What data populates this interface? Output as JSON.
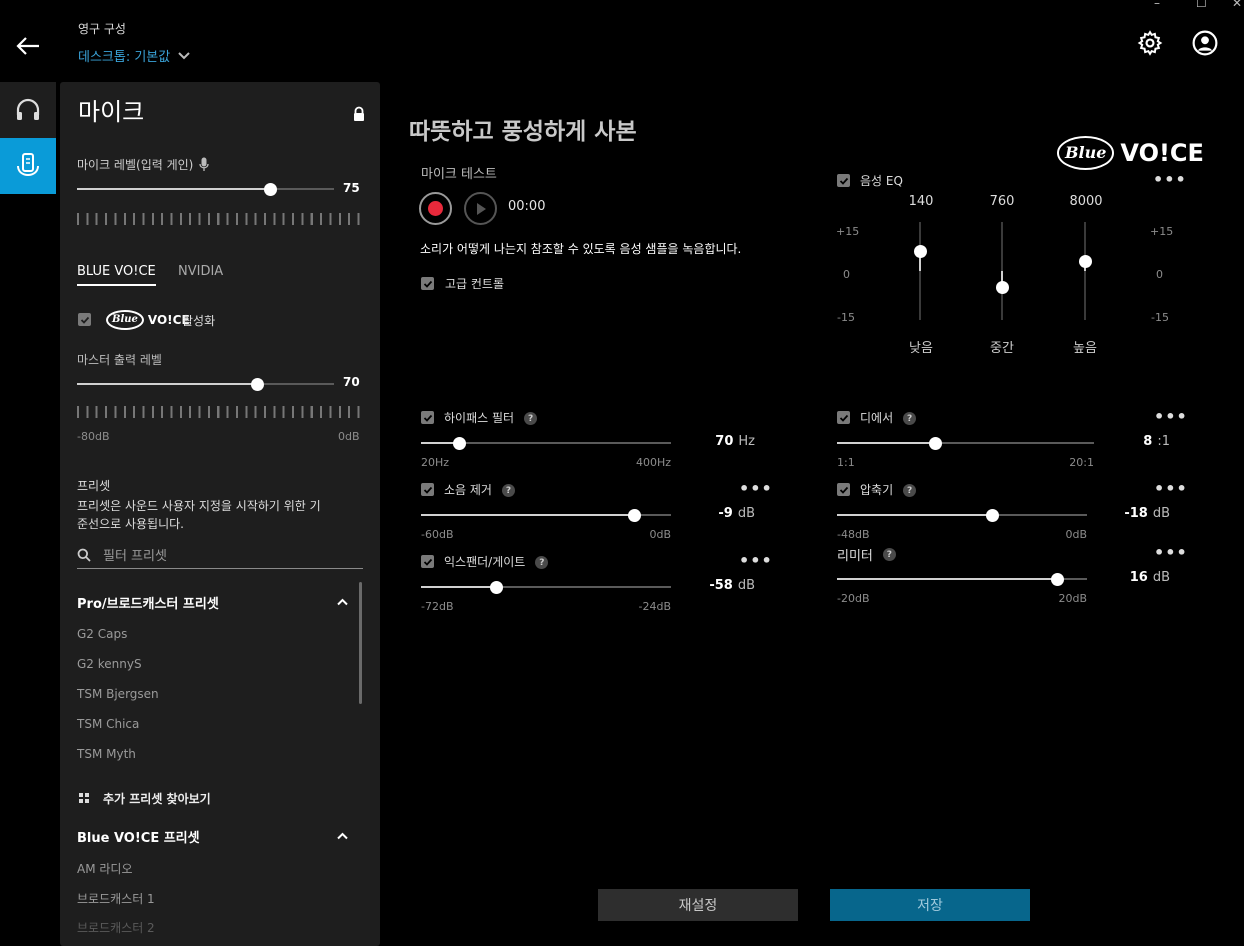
{
  "window": {
    "minimize": "–",
    "maximize": "☐",
    "close": "✕"
  },
  "header": {
    "config_title": "영구 구성",
    "profile": "데스크톱: 기본값"
  },
  "panel": {
    "title": "마이크",
    "mic_level_label": "마이크 레벨(입력 게인)",
    "mic_level_value": "75",
    "mic_level": 0.75,
    "tabs": [
      "BLUE VO!CE",
      "NVIDIA"
    ],
    "bv_logo_blue": "Blue",
    "bv_logo_voice": "VO!CE",
    "activate_label": "활성화",
    "master_label": "마스터 출력 레벨",
    "master_value": "70",
    "master_level": 0.7,
    "master_min": "-80dB",
    "master_max": "0dB",
    "presets_title": "프리셋",
    "presets_desc_1": "프리셋은 사운드 사용자 지정을 시작하기 위한 기",
    "presets_desc_2": "준선으로 사용됩니다.",
    "filter_placeholder": "필터 프리셋",
    "group1_title": "Pro/브로드캐스터 프리셋",
    "group1_items": [
      "G2 Caps",
      "G2 kennyS",
      "TSM Bjergsen",
      "TSM Chica",
      "TSM Myth"
    ],
    "browse_more": "추가 프리셋 찾아보기",
    "group2_title": "Blue VO!CE 프리셋",
    "group2_items": [
      "AM 라디오",
      "브로드캐스터 1",
      "브로드캐스터 2"
    ]
  },
  "main": {
    "title": "따뜻하고 풍성하게 사본",
    "logo_blue": "Blue",
    "logo_voice": "VO!CE",
    "mic_test_label": "마이크 테스트",
    "timer": "00:00",
    "record_hint": "소리가 어떻게 나는지 참조할 수 있도록 음성 샘플을 녹음합니다.",
    "advanced_label": "고급 컨트롤",
    "eq": {
      "label": "음성 EQ",
      "more": "•••",
      "scale_top": "+15",
      "scale_mid": "0",
      "scale_bot": "-15",
      "bands": [
        {
          "freq": "140",
          "name": "낮음",
          "gain": 6
        },
        {
          "freq": "760",
          "name": "중간",
          "gain": -5
        },
        {
          "freq": "8000",
          "name": "높음",
          "gain": 3
        }
      ]
    },
    "controls": {
      "highpass": {
        "label": "하이패스 필터",
        "value": "70",
        "unit": "Hz",
        "min": "20Hz",
        "max": "400Hz",
        "level": 0.15
      },
      "noise": {
        "label": "소음 제거",
        "value": "-9",
        "unit": "dB",
        "min": "-60dB",
        "max": "0dB",
        "level": 0.85
      },
      "expander": {
        "label": "익스팬더/게이트",
        "value": "-58",
        "unit": "dB",
        "min": "-72dB",
        "max": "-24dB",
        "level": 0.3
      },
      "deesser": {
        "label": "디에서",
        "value": "8",
        "unit": ":1",
        "min": "1:1",
        "max": "20:1",
        "level": 0.38
      },
      "compressor": {
        "label": "압축기",
        "value": "-18",
        "unit": "dB",
        "min": "-48dB",
        "max": "0dB",
        "level": 0.62
      },
      "limiter": {
        "label": "리미터",
        "value": "16",
        "unit": "dB",
        "min": "-20dB",
        "max": "20dB",
        "level": 0.88
      }
    },
    "help": "?",
    "more": "•••",
    "reset": "재설정",
    "save": "저장"
  }
}
